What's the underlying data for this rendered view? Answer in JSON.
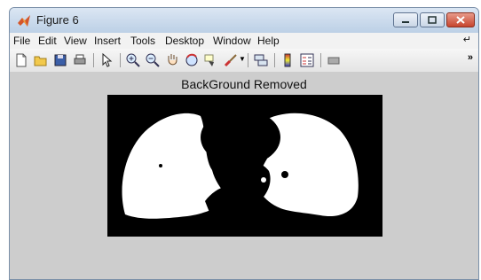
{
  "window": {
    "title": "Figure 6"
  },
  "menu": [
    "File",
    "Edit",
    "View",
    "Insert",
    "Tools",
    "Desktop",
    "Window",
    "Help"
  ],
  "toolbar": {
    "icons": [
      "new-figure-icon",
      "open-file-icon",
      "save-icon",
      "print-icon",
      "pointer-icon",
      "zoom-in-icon",
      "zoom-out-icon",
      "pan-icon",
      "rotate-icon",
      "data-cursor-icon",
      "brush-icon",
      "link-icon",
      "colorbar-icon",
      "legend-icon",
      "hide-plot-tools-icon"
    ]
  },
  "figure": {
    "axes_title": "BackGround Removed"
  },
  "colors": {
    "background": "#cdcdcd",
    "image_bg": "#000000",
    "mask": "#ffffff"
  }
}
